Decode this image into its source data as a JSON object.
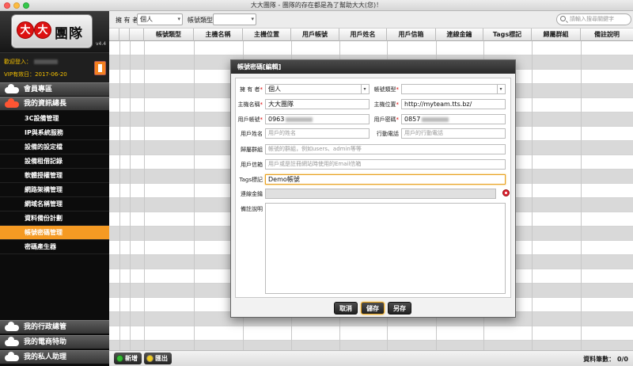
{
  "window": {
    "title": "大大團隊 - 團隊的存在都是為了幫助大大(您)！"
  },
  "sidebar": {
    "logo_mark_1": "大",
    "logo_mark_2": "大",
    "logo_text": "團隊",
    "version": "v4.4",
    "welcome_label": "歡迎登入：",
    "vip_label": "VIP有效日：2017-06-20",
    "sections": [
      {
        "label": "會員專區"
      },
      {
        "label": "我的資訊總長"
      },
      {
        "label": "我的行政總管"
      },
      {
        "label": "我的電商特助"
      },
      {
        "label": "我的私人助理"
      }
    ],
    "items": [
      {
        "label": "3C設備管理"
      },
      {
        "label": "IP與系統服務"
      },
      {
        "label": "設備的設定檔"
      },
      {
        "label": "設備租借記錄"
      },
      {
        "label": "軟體授權管理"
      },
      {
        "label": "網路架構管理"
      },
      {
        "label": "網域名稱管理"
      },
      {
        "label": "資料備份計劃"
      },
      {
        "label": "帳號密碼管理"
      },
      {
        "label": "密碼產生器"
      }
    ]
  },
  "filter": {
    "owner_label": "擁 有 者",
    "owner_value": "個人",
    "type_label": "帳號類型",
    "type_value": "",
    "search_placeholder": "請輸入搜尋關鍵字"
  },
  "table": {
    "columns": [
      "帳號類型",
      "主機名稱",
      "主機位置",
      "用戶帳號",
      "用戶姓名",
      "用戶信箱",
      "連線金鑰",
      "Tags標記",
      "歸屬群組",
      "備註說明"
    ]
  },
  "bottom": {
    "add_label": "新增",
    "export_label": "匯出",
    "count_label": "資料筆數： 0/0"
  },
  "modal": {
    "title": "帳號密碼[編輯]",
    "owner_label": "擁 有 者",
    "owner_value": "個人",
    "type_label": "帳號類型",
    "type_value": "",
    "host_label": "主機名稱",
    "host_value": "大大團隊",
    "location_label": "主機位置",
    "location_value": "http://myteam.tts.bz/",
    "account_label": "用戶帳號",
    "account_value": "0963",
    "password_label": "用戶密碼",
    "password_value": "0857",
    "name_label": "用戶姓名",
    "name_placeholder": "用戶的姓名",
    "phone_label": "行動電話",
    "phone_placeholder": "用戶的行動電話",
    "group_label": "歸屬群組",
    "group_placeholder": "帳號的群組，例如users、admin等等",
    "email_label": "用戶信箱",
    "email_placeholder": "用戶或是註冊網站時使用的Email信箱",
    "tags_label": "Tags標記",
    "tags_value": "Demo帳號",
    "key_label": "連線金鑰",
    "note_label": "備註說明",
    "cancel_label": "取消",
    "save_label": "儲存",
    "saveas_label": "另存"
  }
}
